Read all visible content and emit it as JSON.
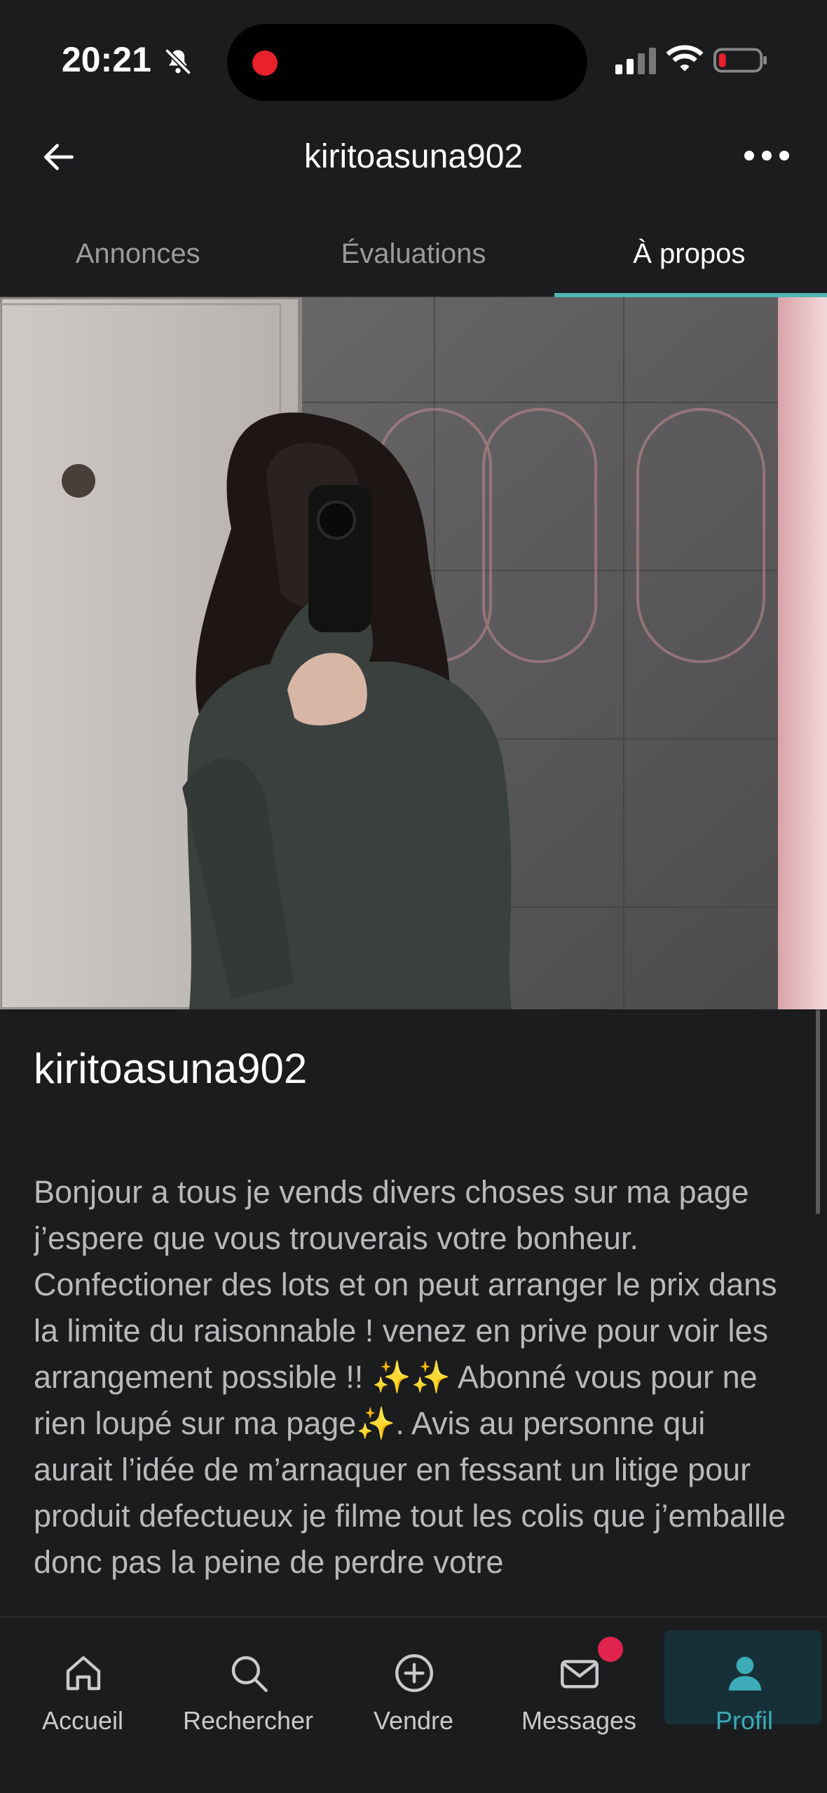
{
  "status_bar": {
    "time": "20:21",
    "icons": [
      "bell-slash-icon",
      "recording-dot-icon",
      "cellular-signal-icon",
      "wifi-icon",
      "low-battery-icon"
    ]
  },
  "header": {
    "title": "kiritoasuna902",
    "back_icon": "arrow-left-icon",
    "more_icon": "more-horizontal-icon"
  },
  "tabs": [
    {
      "label": "Annonces",
      "active": false
    },
    {
      "label": "Évaluations",
      "active": false
    },
    {
      "label": "À propos",
      "active": true
    }
  ],
  "profile": {
    "username": "kiritoasuna902",
    "bio": "Bonjour a tous je vends divers choses sur ma page j’espere que vous trouverais votre bonheur. Confectioner des lots et on peut arranger le prix dans la limite du raisonnable ! venez en prive pour voir les arrangement possible !! ✨✨   Abonné vous pour ne rien loupé sur ma page✨.  Avis au personne qui aurait l’idée de m’arnaquer en fessant un litige pour produit defectueux je filme tout les colis que j’emballle donc pas la peine de perdre votre"
  },
  "bottom_nav": [
    {
      "label": "Accueil",
      "icon": "home-icon",
      "active": false
    },
    {
      "label": "Rechercher",
      "icon": "search-icon",
      "active": false
    },
    {
      "label": "Vendre",
      "icon": "plus-circle-icon",
      "active": false
    },
    {
      "label": "Messages",
      "icon": "mail-icon",
      "active": false,
      "badge": true
    },
    {
      "label": "Profil",
      "icon": "user-icon",
      "active": true
    }
  ],
  "colors": {
    "background": "#1b1c1e",
    "accent": "#4fb6b2",
    "active_nav": "#3dabb8",
    "badge": "#e0244f"
  }
}
